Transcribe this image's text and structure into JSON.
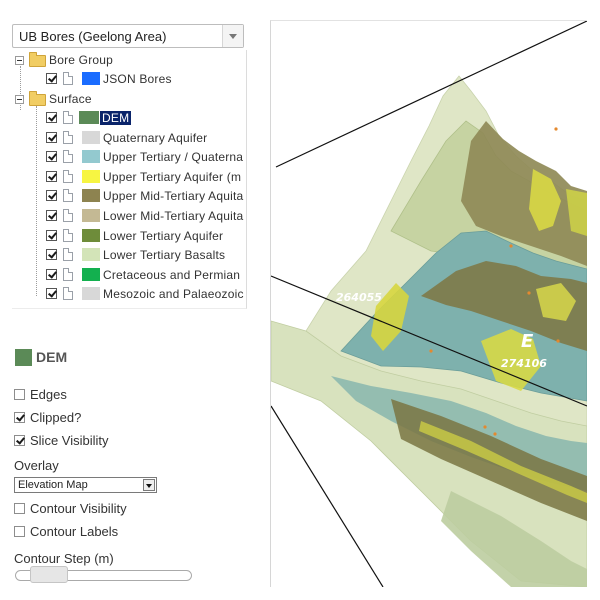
{
  "dataset": {
    "selected": "UB Bores (Geelong Area)"
  },
  "tree": {
    "groups": [
      {
        "label": "Bore Group"
      },
      {
        "label": "Surface"
      }
    ],
    "layers": [
      {
        "label": "JSON Bores",
        "color": "#1a6cff",
        "checked": true
      },
      {
        "label": "DEM",
        "color": "#5b8a57",
        "checked": true,
        "selected": true
      },
      {
        "label": "Quaternary Aquifer",
        "color": "#d8d8d8",
        "checked": true
      },
      {
        "label": "Upper Tertiary / Quaterna",
        "color": "#93c9cf",
        "checked": true
      },
      {
        "label": "Upper Tertiary Aquifer (m",
        "color": "#f7f542",
        "checked": true
      },
      {
        "label": "Upper Mid-Tertiary Aquita",
        "color": "#8d8350",
        "checked": true
      },
      {
        "label": "Lower Mid-Tertiary Aquita",
        "color": "#c4b994",
        "checked": true
      },
      {
        "label": "Lower Tertiary Aquifer",
        "color": "#6e8c3a",
        "checked": true
      },
      {
        "label": "Lower Tertiary Basalts",
        "color": "#d3e4b8",
        "checked": true
      },
      {
        "label": "Cretaceous and Permian",
        "color": "#13b04f",
        "checked": true
      },
      {
        "label": "Mesozoic and Palaeozoic",
        "color": "#d8d8d8",
        "checked": true
      }
    ]
  },
  "properties": {
    "title": "DEM",
    "color": "#5b8a57",
    "edges": {
      "label": "Edges",
      "checked": false
    },
    "clipped": {
      "label": "Clipped?",
      "checked": true
    },
    "slice": {
      "label": "Slice Visibility",
      "checked": true
    },
    "overlay_label": "Overlay",
    "overlay_value": "Elevation Map",
    "contour_visibility": {
      "label": "Contour Visibility",
      "checked": false
    },
    "contour_labels": {
      "label": "Contour Labels",
      "checked": false
    },
    "contour_step_label": "Contour Step (m)",
    "contour_step_value": 0.15
  },
  "viewport": {
    "labels": [
      {
        "text": "264055"
      },
      {
        "text": "274106"
      },
      {
        "text": "E"
      }
    ],
    "terrain_colors": {
      "pale_green": "#d6dfb9",
      "sage": "#a9bf8f",
      "teal": "#79adac",
      "olive": "#7f7a48",
      "dark_olive": "#6d6a3c",
      "yellow": "#d8d845",
      "light_grey_green": "#e3e8d4"
    }
  }
}
